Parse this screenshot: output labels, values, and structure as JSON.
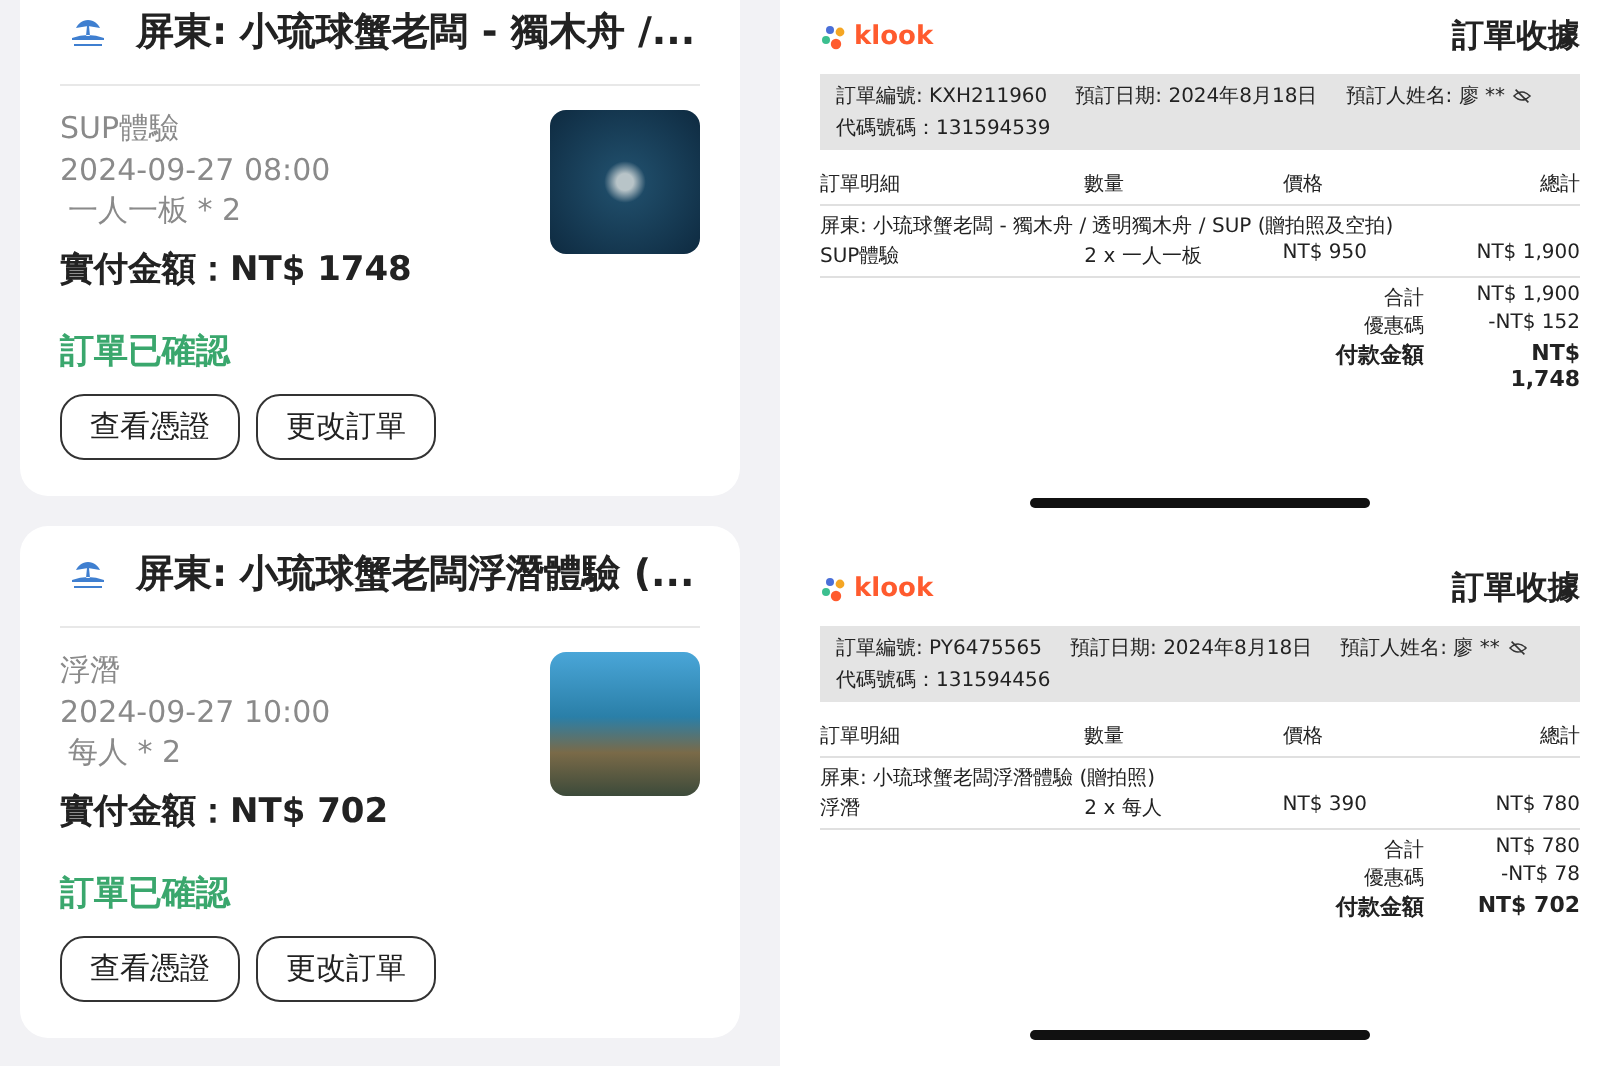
{
  "orders": [
    {
      "title": "屏東: 小琉球蟹老闆 - 獨木舟 /...",
      "option": "SUP體驗",
      "datetime": "2024-09-27 08:00",
      "quantity": "一人一板 * 2",
      "paid": "實付金額：NT$ 1748",
      "status": "訂單已確認",
      "buttons": [
        "查看憑證",
        "更改訂單"
      ]
    },
    {
      "title": "屏東: 小琉球蟹老闆浮潛體驗 (...",
      "option": "浮潛",
      "datetime": "2024-09-27 10:00",
      "quantity": "每人 * 2",
      "paid": "實付金額：NT$ 702",
      "status": "訂單已確認",
      "buttons": [
        "查看憑證",
        "更改訂單"
      ]
    }
  ],
  "receipts": [
    {
      "logo": "klook",
      "title": "訂單收據",
      "info": [
        "訂單編號: KXH211960",
        "預訂日期: 2024年8月18日",
        "預訂人姓名: 廖 **",
        "代碼號碼：131594539"
      ],
      "columns": [
        "訂單明細",
        "數量",
        "價格",
        "總計"
      ],
      "item_title": "屏東: 小琉球蟹老闆 - 獨木舟 / 透明獨木舟 / SUP (贈拍照及空拍)",
      "row": [
        "SUP體驗",
        "2 x 一人一板",
        "NT$ 950",
        "NT$ 1,900"
      ],
      "totals": [
        {
          "label": "合計",
          "value": "NT$ 1,900"
        },
        {
          "label": "優惠碼",
          "value": "-NT$ 152"
        }
      ],
      "total": {
        "label": "付款金額",
        "value": "NT$ 1,748"
      }
    },
    {
      "logo": "klook",
      "title": "訂單收據",
      "info": [
        "訂單編號: PY6475565",
        "預訂日期: 2024年8月18日",
        "預訂人姓名: 廖 **",
        "代碼號碼：131594456"
      ],
      "columns": [
        "訂單明細",
        "數量",
        "價格",
        "總計"
      ],
      "item_title": "屏東: 小琉球蟹老闆浮潛體驗 (贈拍照)",
      "row": [
        "浮潛",
        "2 x 每人",
        "NT$ 390",
        "NT$ 780"
      ],
      "totals": [
        {
          "label": "合計",
          "value": "NT$ 780"
        },
        {
          "label": "優惠碼",
          "value": "-NT$ 78"
        }
      ],
      "total": {
        "label": "付款金額",
        "value": "NT$ 702"
      }
    }
  ]
}
